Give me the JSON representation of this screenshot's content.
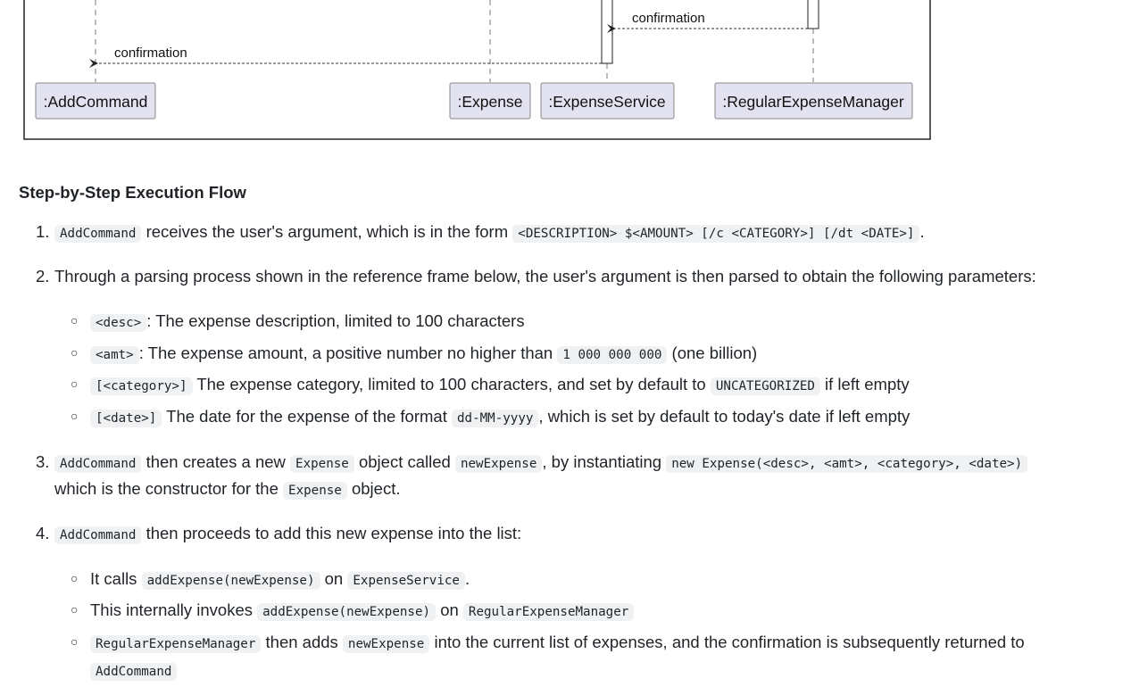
{
  "diagram": {
    "participants": [
      ":AddCommand",
      ":Expense",
      ":ExpenseService",
      ":RegularExpenseManager"
    ],
    "messages": [
      "confirmation",
      "confirmation"
    ]
  },
  "heading": "Step-by-Step Execution Flow",
  "steps": {
    "s1": {
      "num": "1.",
      "c1": "AddCommand",
      "t1": "receives the user's argument, which is in the form",
      "c2": "<DESCRIPTION> $<AMOUNT> [/c <CATEGORY>] [/dt <DATE>]",
      "t2": "."
    },
    "s2": {
      "num": "2.",
      "t1": "Through a parsing process shown in the reference frame below, the user's argument is then parsed to obtain the following parameters:"
    },
    "s2a": {
      "c1": "<desc>",
      "t1": ": The expense description, limited to 100 characters"
    },
    "s2b": {
      "c1": "<amt>",
      "t1": ": The expense amount, a positive number no higher than",
      "c2": "1 000 000 000",
      "t2": "(one billion)"
    },
    "s2c": {
      "c1": "[<category>]",
      "t1": "The expense category, limited to 100 characters, and set by default to",
      "c2": "UNCATEGORIZED",
      "t2": "if left empty"
    },
    "s2d": {
      "c1": "[<date>]",
      "t1": "The date for the expense of the format",
      "c2": "dd-MM-yyyy",
      "t2": ", which is set by default to today's date if left empty"
    },
    "s3": {
      "num": "3.",
      "c1": "AddCommand",
      "t1": "then creates a new",
      "c2": "Expense",
      "t2": "object called",
      "c3": "newExpense",
      "t3": ", by instantiating",
      "c4": "new Expense(<desc>, <amt>, <category>, <date>)",
      "t4": "which is the constructor for the",
      "c5": "Expense",
      "t5": "object."
    },
    "s4": {
      "num": "4.",
      "c1": "AddCommand",
      "t1": "then proceeds to add this new expense into the list:"
    },
    "s4a": {
      "t1": "It calls",
      "c1": "addExpense(newExpense)",
      "t2": "on",
      "c2": "ExpenseService",
      "t3": "."
    },
    "s4b": {
      "t1": "This internally invokes",
      "c1": "addExpense(newExpense)",
      "t2": "on",
      "c2": "RegularExpenseManager"
    },
    "s4c": {
      "c1": "RegularExpenseManager",
      "t1": "then adds",
      "c2": "newExpense",
      "t2": "into the current list of expenses, and the confirmation is subsequently returned to",
      "c3": "AddCommand"
    }
  },
  "bullet": "○"
}
